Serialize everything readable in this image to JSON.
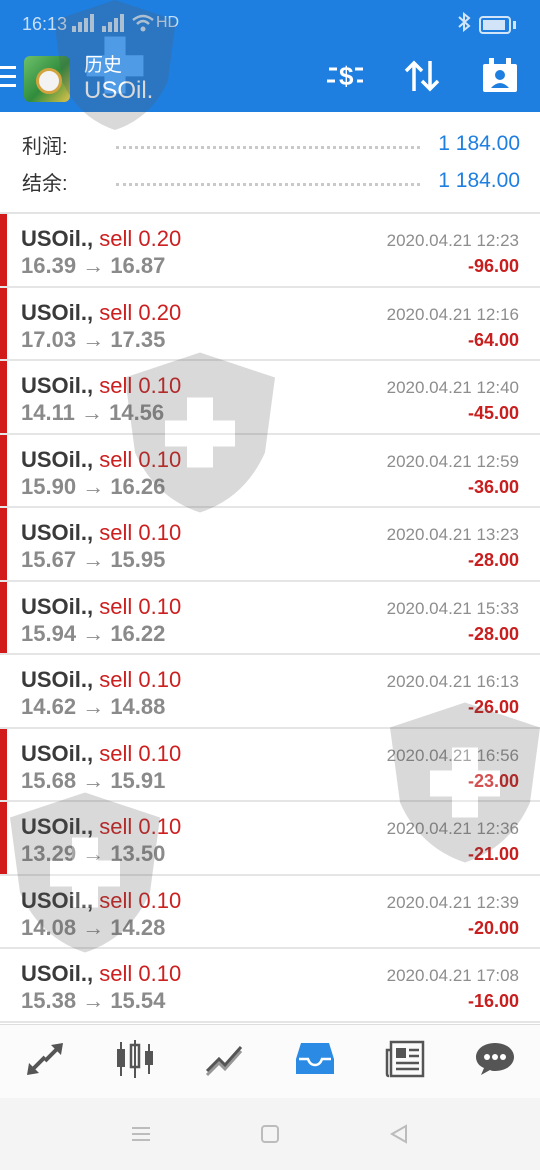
{
  "status_bar": {
    "time": "16:13",
    "signal1": "4G",
    "signal2": "2G",
    "network": "HD"
  },
  "header": {
    "subtitle": "历史",
    "title": "USOil."
  },
  "summary": {
    "profit_label": "利润:",
    "profit_value": "1 184.00",
    "balance_label": "结余:",
    "balance_value": "1 184.00"
  },
  "trades": [
    {
      "symbol": "USOil.,",
      "side": "sell 0.20",
      "open": "16.39",
      "close": "16.87",
      "datetime": "2020.04.21 12:23",
      "pnl": "-96.00",
      "marked": true
    },
    {
      "symbol": "USOil.,",
      "side": "sell 0.20",
      "open": "17.03",
      "close": "17.35",
      "datetime": "2020.04.21 12:16",
      "pnl": "-64.00",
      "marked": true
    },
    {
      "symbol": "USOil.,",
      "side": "sell 0.10",
      "open": "14.11",
      "close": "14.56",
      "datetime": "2020.04.21 12:40",
      "pnl": "-45.00",
      "marked": true
    },
    {
      "symbol": "USOil.,",
      "side": "sell 0.10",
      "open": "15.90",
      "close": "16.26",
      "datetime": "2020.04.21 12:59",
      "pnl": "-36.00",
      "marked": true
    },
    {
      "symbol": "USOil.,",
      "side": "sell 0.10",
      "open": "15.67",
      "close": "15.95",
      "datetime": "2020.04.21 13:23",
      "pnl": "-28.00",
      "marked": true
    },
    {
      "symbol": "USOil.,",
      "side": "sell 0.10",
      "open": "15.94",
      "close": "16.22",
      "datetime": "2020.04.21 15:33",
      "pnl": "-28.00",
      "marked": true
    },
    {
      "symbol": "USOil.,",
      "side": "sell 0.10",
      "open": "14.62",
      "close": "14.88",
      "datetime": "2020.04.21 16:13",
      "pnl": "-26.00",
      "marked": false
    },
    {
      "symbol": "USOil.,",
      "side": "sell 0.10",
      "open": "15.68",
      "close": "15.91",
      "datetime": "2020.04.21 16:56",
      "pnl": "-23.00",
      "marked": true
    },
    {
      "symbol": "USOil.,",
      "side": "sell 0.10",
      "open": "13.29",
      "close": "13.50",
      "datetime": "2020.04.21 12:36",
      "pnl": "-21.00",
      "marked": true
    },
    {
      "symbol": "USOil.,",
      "side": "sell 0.10",
      "open": "14.08",
      "close": "14.28",
      "datetime": "2020.04.21 12:39",
      "pnl": "-20.00",
      "marked": false
    },
    {
      "symbol": "USOil.,",
      "side": "sell 0.10",
      "open": "15.38",
      "close": "15.54",
      "datetime": "2020.04.21 17:08",
      "pnl": "-16.00",
      "marked": false
    }
  ],
  "arrow": "→",
  "colors": {
    "accent": "#1f7fe0",
    "loss": "#c81e1e",
    "marker": "#d31a1a"
  },
  "nav_icons": [
    "trade-arrows-icon",
    "candlestick-icon",
    "chart-line-icon",
    "inbox-history-icon",
    "news-icon",
    "chat-icon"
  ]
}
